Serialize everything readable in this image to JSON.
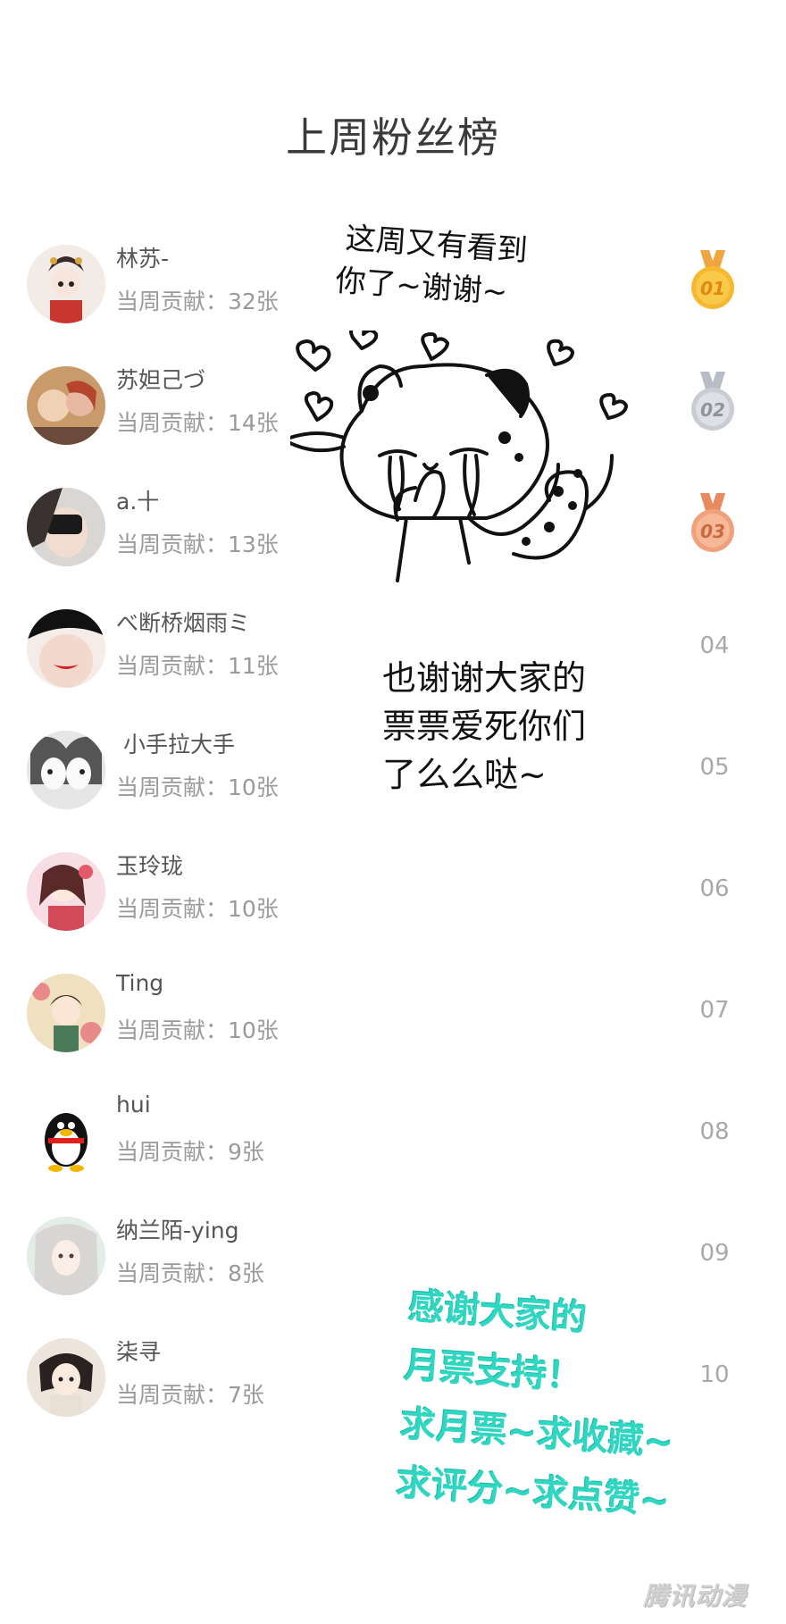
{
  "title": "上周粉丝榜",
  "rows": [
    {
      "name": "林苏-",
      "contribution": "当周贡献：32张",
      "rank": "01"
    },
    {
      "name": "苏妲己づ",
      "contribution": "当周贡献：14张",
      "rank": "02"
    },
    {
      "name": "a.十",
      "contribution": "当周贡献：13张",
      "rank": "03"
    },
    {
      "name": "べ断桥烟雨ミ",
      "contribution": "当周贡献：11张",
      "rank": "04"
    },
    {
      "name": "小手拉大手",
      "contribution": "当周贡献：10张",
      "rank": "05"
    },
    {
      "name": "玉玲珑",
      "contribution": "当周贡献：10张",
      "rank": "06"
    },
    {
      "name": "Ting",
      "contribution": "当周贡献：10张",
      "rank": "07"
    },
    {
      "name": "hui",
      "contribution": "当周贡献：9张",
      "rank": "08"
    },
    {
      "name": "纳兰陌-ying",
      "contribution": "当周贡献：8张",
      "rank": "09"
    },
    {
      "name": "柒寻",
      "contribution": "当周贡献：7张",
      "rank": "10"
    }
  ],
  "medal_colors": {
    "gold": "#f5b82e",
    "silver": "#c9ccd2",
    "bronze": "#f0a07a"
  },
  "bubble_text": {
    "line1": "这周又有看到",
    "line2": "你了~谢谢~"
  },
  "caption": {
    "line1": "也谢谢大家的",
    "line2": "票票爱死你们",
    "line3": "了么么哒~"
  },
  "promo": {
    "line1": "感谢大家的",
    "line2": "月票支持！",
    "line3": "求月票~求收藏~",
    "line4": "求评分~求点赞~",
    "color": "#2fd6c2"
  },
  "watermark": "腾讯动漫"
}
